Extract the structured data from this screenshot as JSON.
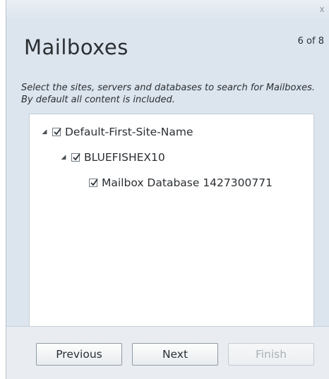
{
  "window": {
    "close_glyph": "x"
  },
  "header": {
    "title": "Mailboxes",
    "page_counter": "6 of 8"
  },
  "description": "Select the sites, servers and databases to search for Mailboxes.  By default all content is included.",
  "tree": {
    "site": {
      "label": "Default-First-Site-Name",
      "checked": true,
      "expanded": true
    },
    "server": {
      "label": "BLUEFISHEX10",
      "checked": true,
      "expanded": true
    },
    "database": {
      "label": "Mailbox Database 1427300771",
      "checked": true
    }
  },
  "footer": {
    "previous_label": "Previous",
    "next_label": "Next",
    "finish_label": "Finish"
  },
  "icons": {
    "close": "close-icon",
    "expander": "expanded-triangle-icon",
    "checkbox": "checkmark-icon"
  },
  "colors": {
    "panel_background": "#dce4ed",
    "footer_background": "#e9edf1",
    "disabled_text": "#a9b0b7"
  }
}
